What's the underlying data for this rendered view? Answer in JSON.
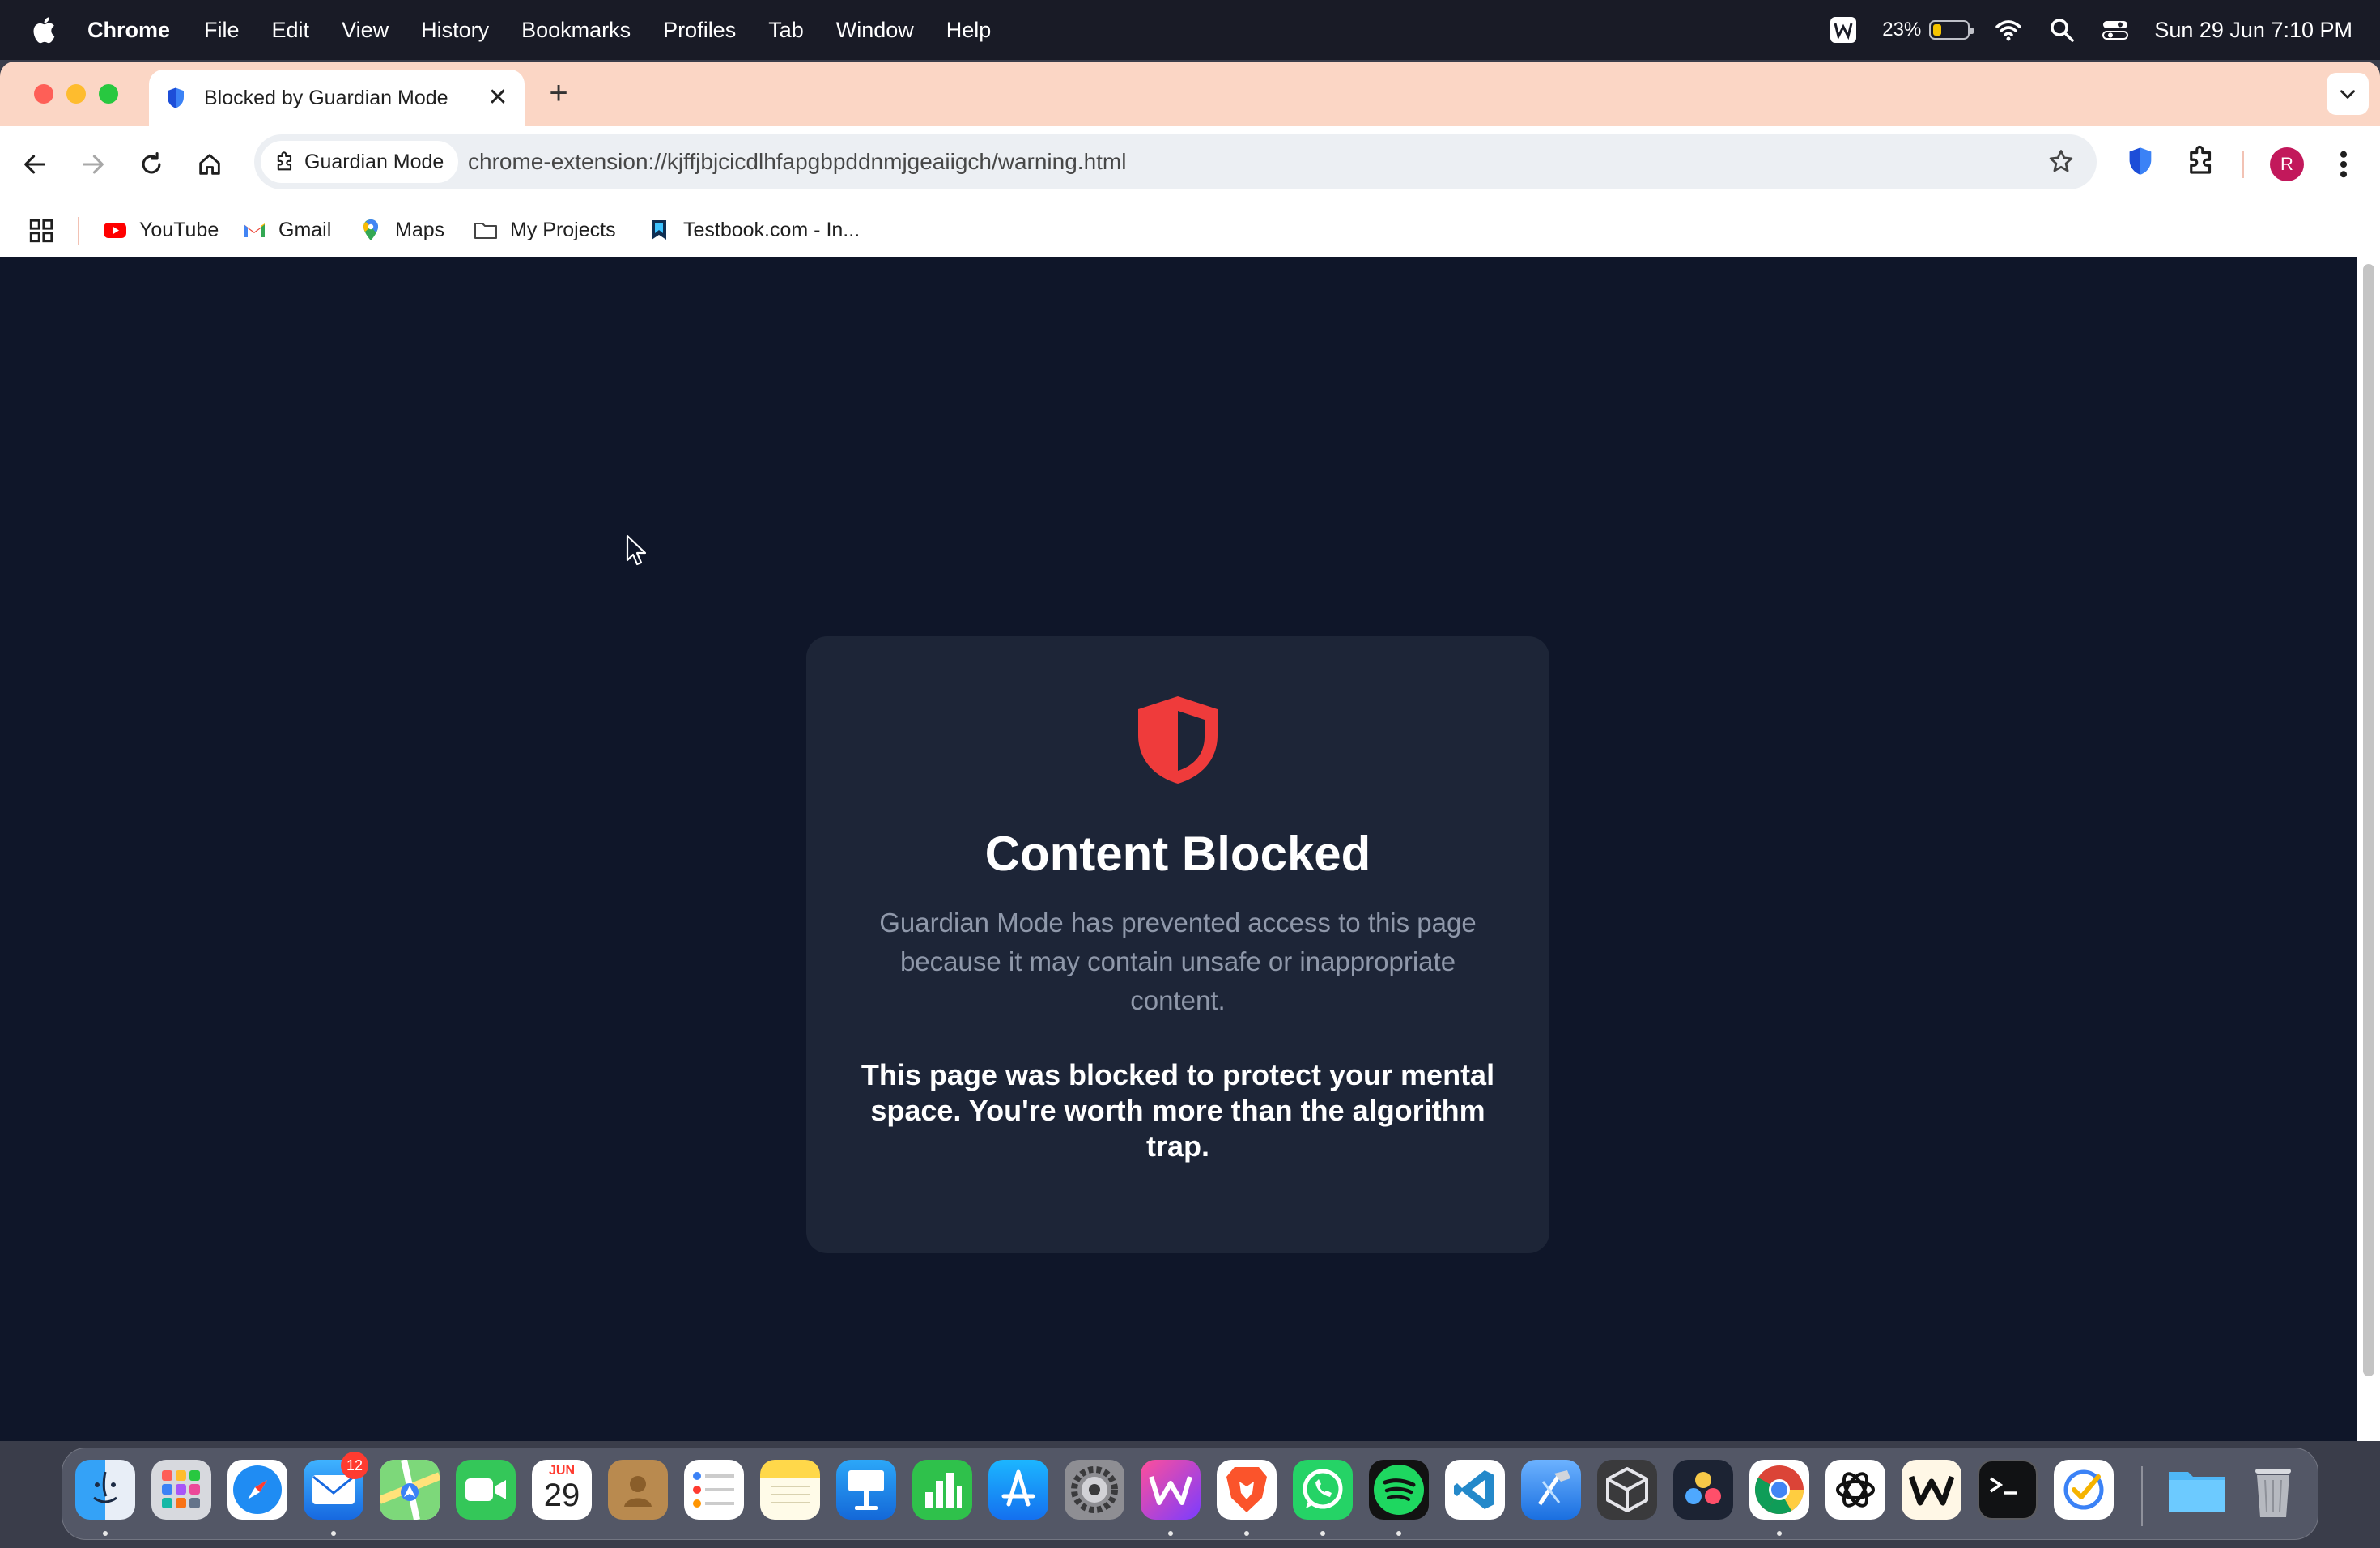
{
  "menubar": {
    "app_name": "Chrome",
    "items": [
      "File",
      "Edit",
      "View",
      "History",
      "Bookmarks",
      "Profiles",
      "Tab",
      "Window",
      "Help"
    ],
    "battery_percent": "23%",
    "battery_level": 0.23,
    "clock": "Sun 29 Jun  7:10 PM"
  },
  "tab": {
    "title": "Blocked by Guardian Mode",
    "close_glyph": "✕"
  },
  "new_tab_glyph": "+",
  "omnibox": {
    "chip_label": "Guardian Mode",
    "url": "chrome-extension://kjffjbjcicdlhfapgbpddnmjgeaiigch/warning.html"
  },
  "profile_initial": "R",
  "bookmarks": [
    {
      "label": "YouTube",
      "icon": "youtube-icon"
    },
    {
      "label": "Gmail",
      "icon": "gmail-icon"
    },
    {
      "label": "Maps",
      "icon": "maps-icon"
    },
    {
      "label": "My Projects",
      "icon": "folder-icon"
    },
    {
      "label": "Testbook.com - In...",
      "icon": "testbook-icon"
    }
  ],
  "card": {
    "title": "Content Blocked",
    "description": "Guardian Mode has prevented access to this page because it may contain unsafe or inappropriate content.",
    "message": "This page was blocked to protect your mental space. You're worth more than the algorithm trap."
  },
  "dock": {
    "mail_badge": "12",
    "calendar_month": "JUN",
    "calendar_day": "29"
  },
  "colors": {
    "page_bg": "#0f1629",
    "card_bg": "#1d2537",
    "shield_red": "#ef3b3b",
    "tabstrip": "#fbd6c5"
  }
}
